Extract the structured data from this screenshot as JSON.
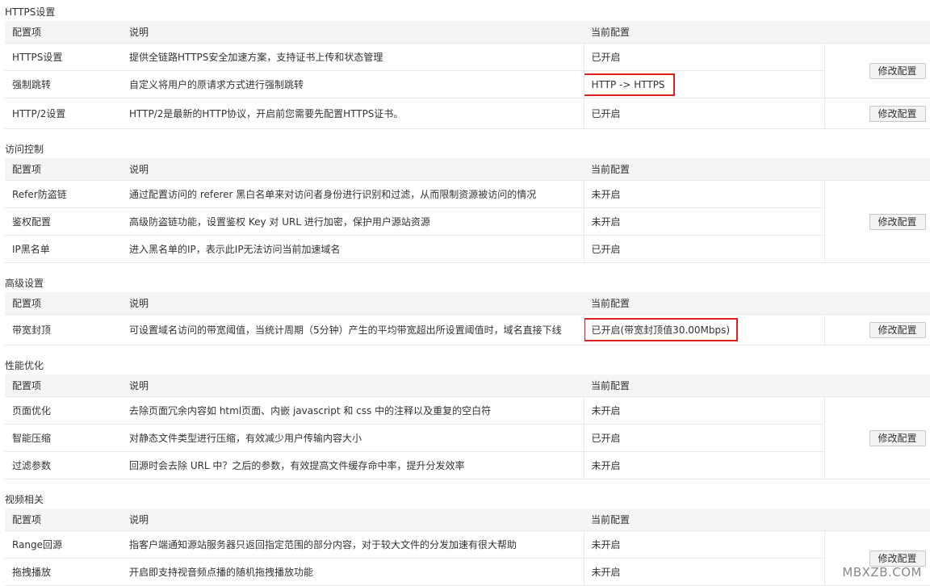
{
  "columns": {
    "item": "配置项",
    "desc": "说明",
    "status": "当前配置"
  },
  "modify_label": "修改配置",
  "sections": [
    {
      "title": "HTTPS设置",
      "rows": [
        {
          "item": "HTTPS设置",
          "desc": "提供全链路HTTPS安全加速方案，支持证书上传和状态管理",
          "status": "已开启"
        },
        {
          "item": "强制跳转",
          "desc": "自定义将用户的原请求方式进行强制跳转",
          "status": "HTTP -> HTTPS"
        },
        {
          "item": "HTTP/2设置",
          "desc": "HTTP/2是最新的HTTP协议，开启前您需要先配置HTTPS证书。",
          "status": "已开启"
        }
      ]
    },
    {
      "title": "访问控制",
      "rows": [
        {
          "item": "Refer防盗链",
          "desc": "通过配置访问的 referer 黑白名单来对访问者身份进行识别和过滤，从而限制资源被访问的情况",
          "status": "未开启"
        },
        {
          "item": "鉴权配置",
          "desc": "高级防盗链功能，设置鉴权 Key 对 URL 进行加密，保护用户源站资源",
          "status": "未开启"
        },
        {
          "item": "IP黑名单",
          "desc": "进入黑名单的IP，表示此IP无法访问当前加速域名",
          "status": "已开启"
        }
      ]
    },
    {
      "title": "高级设置",
      "rows": [
        {
          "item": "带宽封顶",
          "desc": "可设置域名访问的带宽阈值，当统计周期（5分钟）产生的平均带宽超出所设置阈值时，域名直接下线",
          "status": "已开启(带宽封顶值30.00Mbps)"
        }
      ]
    },
    {
      "title": "性能优化",
      "rows": [
        {
          "item": "页面优化",
          "desc": "去除页面冗余内容如 html页面、内嵌 javascript 和 css 中的注释以及重复的空白符",
          "status": "未开启"
        },
        {
          "item": "智能压缩",
          "desc": "对静态文件类型进行压缩，有效减少用户传输内容大小",
          "status": "已开启"
        },
        {
          "item": "过滤参数",
          "desc": "回源时会去除 URL 中？之后的参数，有效提高文件缓存命中率，提升分发效率",
          "status": "未开启"
        }
      ]
    },
    {
      "title": "视频相关",
      "rows": [
        {
          "item": "Range回源",
          "desc": "指客户端通知源站服务器只返回指定范围的部分内容，对于较大文件的分发加速有很大帮助",
          "status": "未开启"
        },
        {
          "item": "拖拽播放",
          "desc": "开启即支持视音频点播的随机拖拽播放功能",
          "status": "未开启"
        }
      ]
    }
  ],
  "watermark": "MBXZB.COM",
  "colors": {
    "enabled": "#2ea121",
    "disabled": "#f5a623",
    "highlight_border": "#e02020"
  }
}
